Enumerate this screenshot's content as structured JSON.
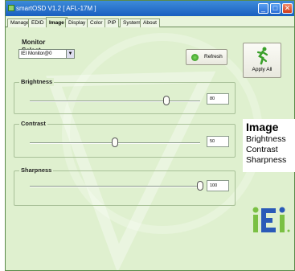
{
  "window": {
    "title": "smartOSD V1.2 [ AFL-17M ]",
    "controls": [
      "minimize",
      "maximize",
      "close"
    ],
    "close_glyph": "✕",
    "minimize_glyph": "_",
    "maximize_glyph": "□"
  },
  "tabs": [
    {
      "label": "Manage",
      "active": false
    },
    {
      "label": "EDID",
      "active": false
    },
    {
      "label": "Image",
      "active": true
    },
    {
      "label": "Display",
      "active": false
    },
    {
      "label": "Color",
      "active": false
    },
    {
      "label": "PIP",
      "active": false
    },
    {
      "label": "System",
      "active": false
    },
    {
      "label": "About",
      "active": false
    }
  ],
  "monitor": {
    "group_label": "Monitor Select",
    "selected": "IEI Monitor@0",
    "dropdown_icon": "chevron-down-icon"
  },
  "refresh": {
    "label": "Refresh",
    "icon": "refresh-icon"
  },
  "apply_all": {
    "label": "Apply All",
    "icon": "running-man-icon"
  },
  "brightness": {
    "label": "Brightness",
    "value": "80",
    "level": 0.8
  },
  "contrast": {
    "label": "Contrast",
    "value": "50",
    "level": 0.5
  },
  "sharpness": {
    "label": "Sharpness",
    "value": "100",
    "level": 1.0
  },
  "overlay": {
    "title": "Image",
    "items": [
      "Brightness",
      "Contrast",
      "Sharpness"
    ]
  },
  "colors": {
    "background": "#dff0cf",
    "accent_green": "#7ac043",
    "logo_blue": "#2a5ab8",
    "titlebar": "#1a5fc0"
  }
}
